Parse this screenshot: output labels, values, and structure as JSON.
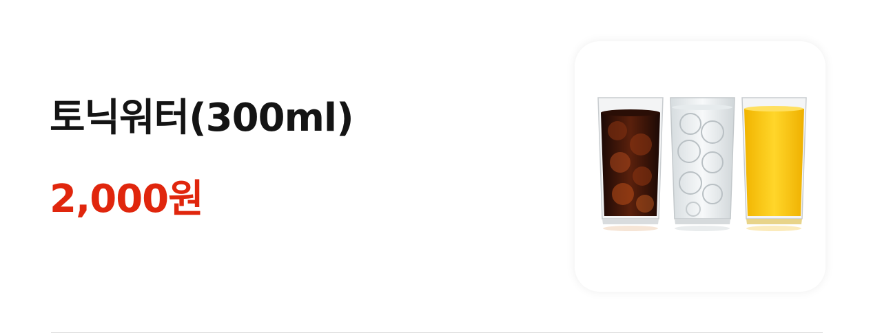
{
  "item": {
    "name": "토닉워터(300ml)",
    "price": "2,000원"
  },
  "image": {
    "icon": "drinks-photo",
    "colors": {
      "cola": "#3a140a",
      "soda": "#e9eef0",
      "orange": "#f6c40a"
    }
  }
}
